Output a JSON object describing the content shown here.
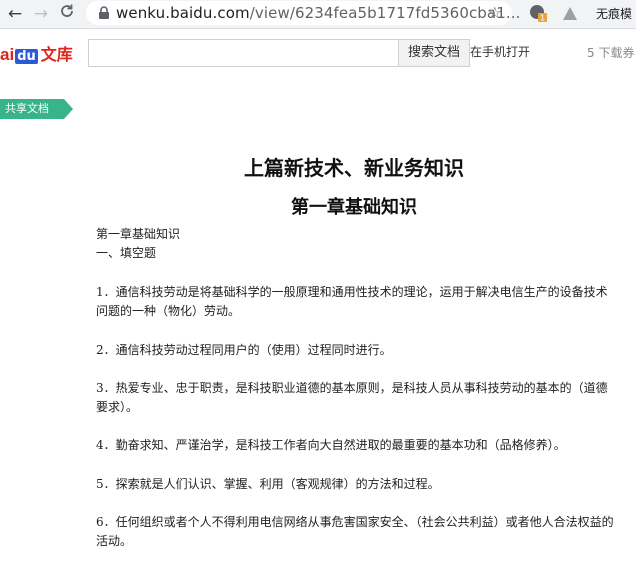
{
  "browser": {
    "url_host": "wenku.baidu.com",
    "url_path": "/view/6234fea5b1717fd5360cba1...",
    "profile_label": "无痕模"
  },
  "header": {
    "logo_bai": "ai",
    "logo_du": "du",
    "logo_wenku": "文库",
    "search_placeholder": "",
    "search_button": "搜索文档",
    "open_on_mobile": "在手机打开",
    "download_count": "5 下载券"
  },
  "share_tag": "共享文档",
  "document": {
    "title": "上篇新技术、新业务知识",
    "chapter": "第一章基础知识",
    "section": "第一章基础知识",
    "subsection": "一、填空题",
    "paragraphs": [
      "1．通信科技劳动是将基础科学的一般原理和通用性技术的理论，运用于解决电信生产的设备技术问题的一种（物化）劳动。",
      "2．通信科技劳动过程同用户的（使用）过程同时进行。",
      "3．热爱专业、忠于职责，是科技职业道德的基本原则，是科技人员从事科技劳动的基本的（道德要求）。",
      "4．勤奋求知、严谨治学，是科技工作者向大自然进取的最重要的基本功和（品格修养）。",
      "5．探索就是人们认识、掌握、利用（客观规律）的方法和过程。",
      "6．任何组织或者个人不得利用电信网络从事危害国家安全、（社会公共利益）或者他人合法权益的活动。"
    ]
  }
}
